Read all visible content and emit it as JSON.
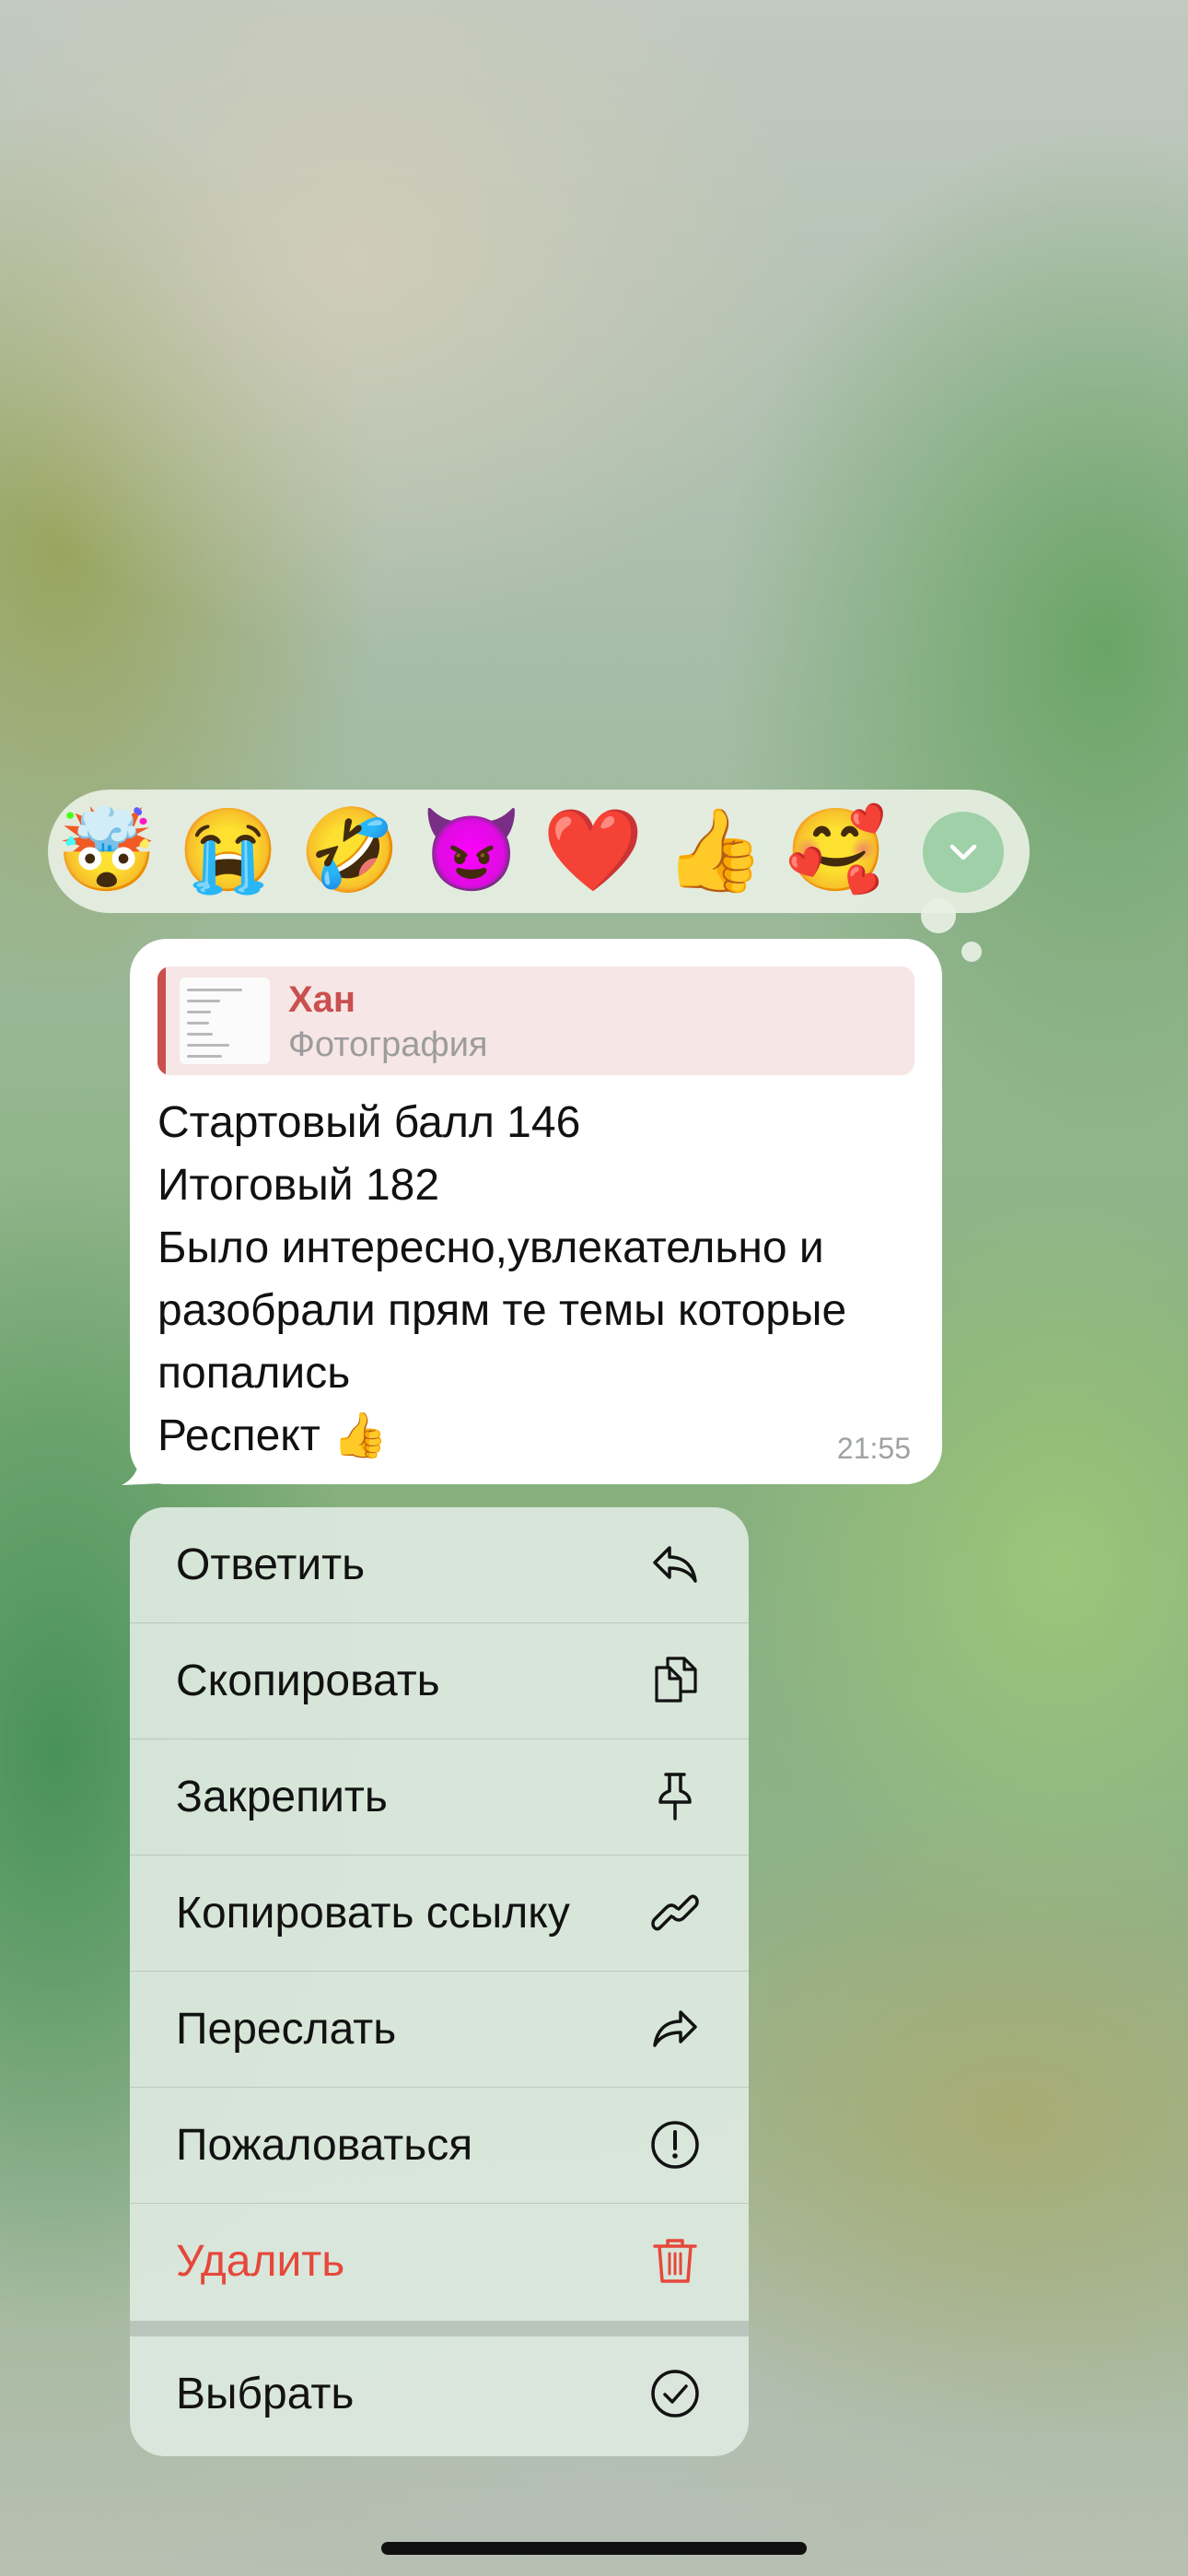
{
  "reactions": {
    "emojis": [
      "🤯",
      "😭",
      "🤣",
      "😈",
      "❤️",
      "👍",
      "🥰"
    ],
    "expand_icon": "chevron-down-icon"
  },
  "message": {
    "reply": {
      "author": "Хан",
      "subtitle": "Фотография"
    },
    "lines": [
      "Стартовый балл  146",
      "Итоговый 182",
      "Было интересно,увлекательно и",
      "разобрали прям те темы которые",
      "попались",
      "Респект 👍"
    ],
    "time": "21:55"
  },
  "menu": {
    "items": [
      {
        "label": "Ответить",
        "icon": "reply-icon"
      },
      {
        "label": "Скопировать",
        "icon": "copy-icon"
      },
      {
        "label": "Закрепить",
        "icon": "pin-icon"
      },
      {
        "label": "Копировать ссылку",
        "icon": "link-icon"
      },
      {
        "label": "Переслать",
        "icon": "forward-icon"
      },
      {
        "label": "Пожаловаться",
        "icon": "report-icon"
      },
      {
        "label": "Удалить",
        "icon": "trash-icon"
      },
      {
        "label": "Выбрать",
        "icon": "checkmark-circle-icon"
      }
    ],
    "destructive_color": "#e5483b"
  },
  "colors": {
    "reply_accent": "#c9504f",
    "expand_button": "#9fd0a7"
  }
}
